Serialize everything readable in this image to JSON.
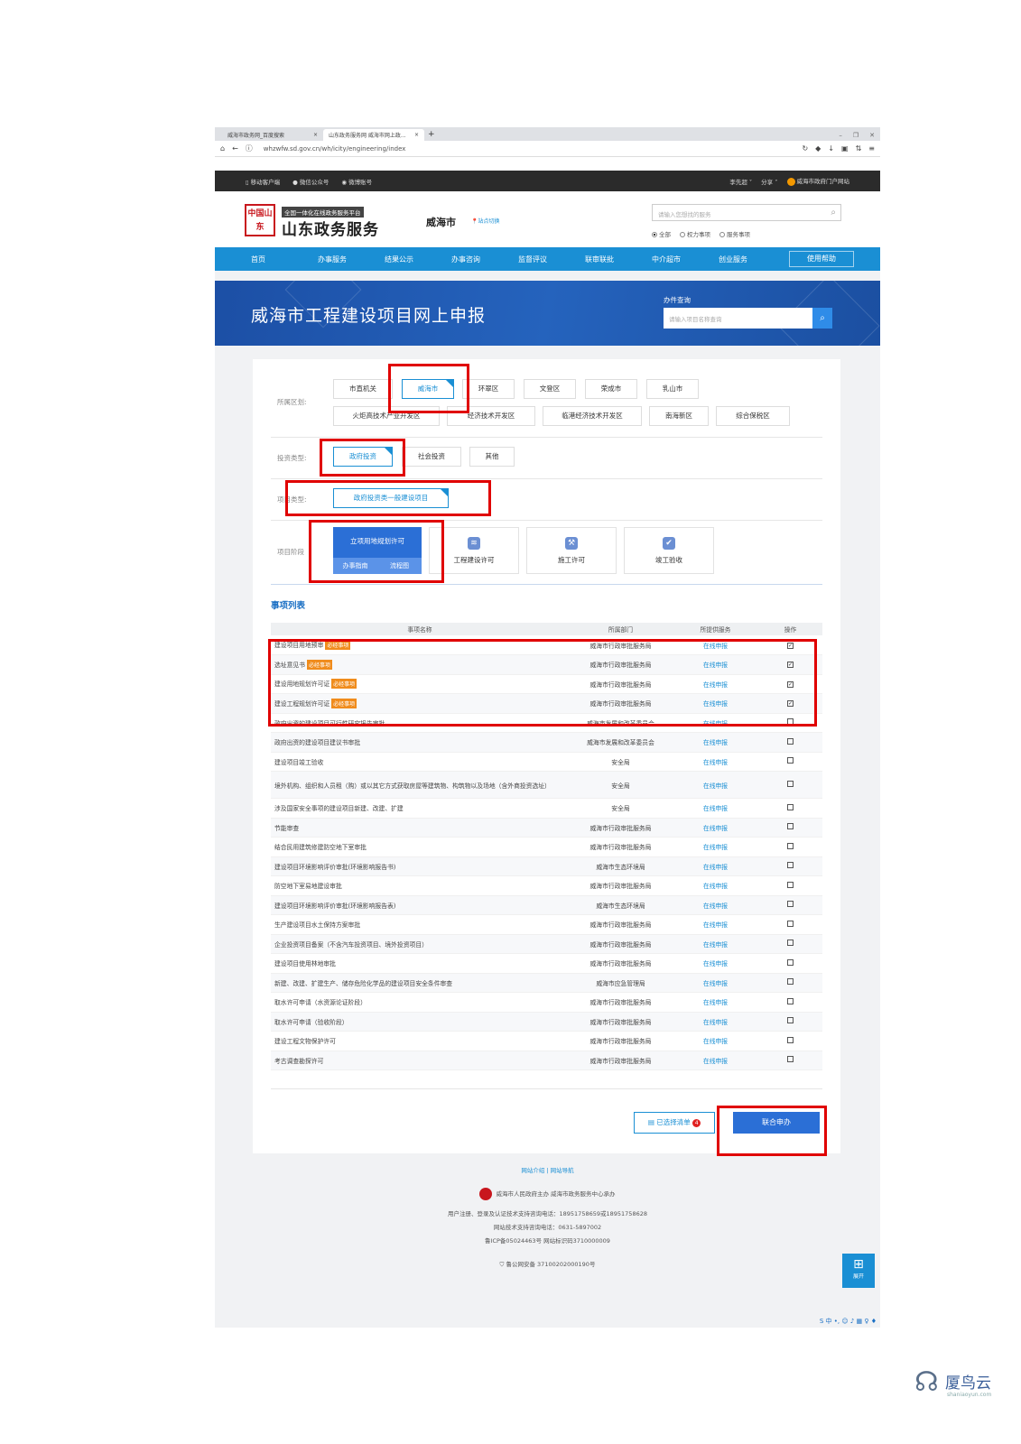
{
  "browser": {
    "tabs": [
      {
        "label": "威海市政务网_百度搜索",
        "active": false
      },
      {
        "label": "山东政务服务网 威海市网上政...",
        "active": true
      }
    ],
    "url": "whzwfw.sd.gov.cn/wh/icity/engineering/index"
  },
  "topbar": {
    "left": [
      "移动客户端",
      "微信公众号",
      "微博账号"
    ],
    "right": [
      "李先超",
      "分享",
      "威海市政府门户网站"
    ]
  },
  "header": {
    "seal_text": "中国山东",
    "tag": "全国一体化在线政务服务平台",
    "title": "山东政务服务",
    "city": "威海市",
    "city_switch": "站点切换",
    "search_placeholder": "请输入您想找的服务",
    "search_scopes": [
      "全部",
      "权力事项",
      "服务事项"
    ]
  },
  "mainnav": {
    "items": [
      "首页",
      "办事服务",
      "结果公示",
      "办事咨询",
      "监督评议",
      "联审联批",
      "中介超市",
      "创业服务"
    ],
    "help": "使用帮助"
  },
  "banner": {
    "title": "威海市工程建设项目网上申报",
    "query_label": "办件查询",
    "query_placeholder": "请输入项目名称查询"
  },
  "filters": {
    "region_label": "所属区划:",
    "regions_row1": [
      "市直机关",
      "威海市",
      "环翠区",
      "文登区",
      "荣成市",
      "乳山市"
    ],
    "regions_row2": [
      "火炬高技术产业开发区",
      "经济技术开发区",
      "临港经济技术开发区",
      "南海新区",
      "综合保税区"
    ],
    "investment_label": "投资类型:",
    "investment_types": [
      "政府投资",
      "社会投资",
      "其他"
    ],
    "project_label": "项目类型:",
    "project_type": "政府投资类一般建设项目",
    "stage_label": "项目阶段",
    "stage_active": "立项用地规划许可",
    "stage_active_links": [
      "办事指南",
      "流程图"
    ],
    "stages": [
      "工程建设许可",
      "施工许可",
      "竣工验收"
    ]
  },
  "list": {
    "title": "事项列表",
    "columns": [
      "事项名称",
      "所属部门",
      "所提供服务",
      "操作"
    ],
    "required_tag": "必经事项",
    "rows": [
      {
        "name": "建设项目用地预审",
        "required": true,
        "dept": "威海市行政审批服务局",
        "service": "在线申报",
        "checked": true
      },
      {
        "name": "选址意见书",
        "required": true,
        "dept": "威海市行政审批服务局",
        "service": "在线申报",
        "checked": true
      },
      {
        "name": "建设用地规划许可证",
        "required": true,
        "dept": "威海市行政审批服务局",
        "service": "在线申报",
        "checked": true
      },
      {
        "name": "建设工程规划许可证",
        "required": true,
        "dept": "威海市行政审批服务局",
        "service": "在线申报",
        "checked": true
      },
      {
        "name": "政府出资的建设项目可行性研究报告审批",
        "required": false,
        "dept": "威海市发展和改革委员会",
        "service": "在线申报",
        "checked": false
      },
      {
        "name": "政府出资的建设项目建议书审批",
        "required": false,
        "dept": "威海市发展和改革委员会",
        "service": "在线申报",
        "checked": false
      },
      {
        "name": "建设项目竣工验收",
        "required": false,
        "dept": "安全局",
        "service": "在线申报",
        "checked": false
      },
      {
        "name": "境外机构、组织和人员租（购）或以其它方式获取房屋等建筑物、构筑物以及场地（含外商投资选址）",
        "required": false,
        "dept": "安全局",
        "service": "在线申报",
        "checked": false
      },
      {
        "name": "涉及国家安全事项的建设项目新建、改建、扩建",
        "required": false,
        "dept": "安全局",
        "service": "在线申报",
        "checked": false
      },
      {
        "name": "节能审查",
        "required": false,
        "dept": "威海市行政审批服务局",
        "service": "在线申报",
        "checked": false
      },
      {
        "name": "结合民用建筑修建防空地下室审批",
        "required": false,
        "dept": "威海市行政审批服务局",
        "service": "在线申报",
        "checked": false
      },
      {
        "name": "建设项目环境影响评价审批(环境影响报告书)",
        "required": false,
        "dept": "威海市生态环境局",
        "service": "在线申报",
        "checked": false
      },
      {
        "name": "防空地下室易地建设审批",
        "required": false,
        "dept": "威海市行政审批服务局",
        "service": "在线申报",
        "checked": false
      },
      {
        "name": "建设项目环境影响评价审批(环境影响报告表)",
        "required": false,
        "dept": "威海市生态环境局",
        "service": "在线申报",
        "checked": false
      },
      {
        "name": "生产建设项目水土保持方案审批",
        "required": false,
        "dept": "威海市行政审批服务局",
        "service": "在线申报",
        "checked": false
      },
      {
        "name": "企业投资项目备案（不含汽车投资项目、境外投资项目）",
        "required": false,
        "dept": "威海市行政审批服务局",
        "service": "在线申报",
        "checked": false
      },
      {
        "name": "建设项目使用林地审批",
        "required": false,
        "dept": "威海市行政审批服务局",
        "service": "在线申报",
        "checked": false
      },
      {
        "name": "新建、改建、扩建生产、储存危险化学品的建设项目安全条件审查",
        "required": false,
        "dept": "威海市应急管理局",
        "service": "在线申报",
        "checked": false
      },
      {
        "name": "取水许可申请（水资源论证阶段）",
        "required": false,
        "dept": "威海市行政审批服务局",
        "service": "在线申报",
        "checked": false
      },
      {
        "name": "取水许可申请（验收阶段）",
        "required": false,
        "dept": "威海市行政审批服务局",
        "service": "在线申报",
        "checked": false
      },
      {
        "name": "建设工程文物保护许可",
        "required": false,
        "dept": "威海市行政审批服务局",
        "service": "在线申报",
        "checked": false
      },
      {
        "name": "考古调查勘探许可",
        "required": false,
        "dept": "威海市行政审批服务局",
        "service": "在线申报",
        "checked": false
      }
    ]
  },
  "actions": {
    "selected_list": "已选择清单",
    "selected_count": "4",
    "joint_apply": "联合申办"
  },
  "footer": {
    "links": [
      "网站介绍",
      "网站导航"
    ],
    "sponsor": "威海市人民政府主办 威海市政务服务中心承办",
    "support_phone": "用户注册、登录及认证技术支持咨询电话：18951758659或18951758628",
    "tech_phone": "网站技术支持咨询电话：0631-5897002",
    "icp": "鲁ICP备05024463号 网站标识码3710000009",
    "police": "鲁公网安备 37100202000190号",
    "expand": "展开"
  },
  "watermark": {
    "text": "厦鸟云",
    "sub": "shaniaoyun.com"
  }
}
